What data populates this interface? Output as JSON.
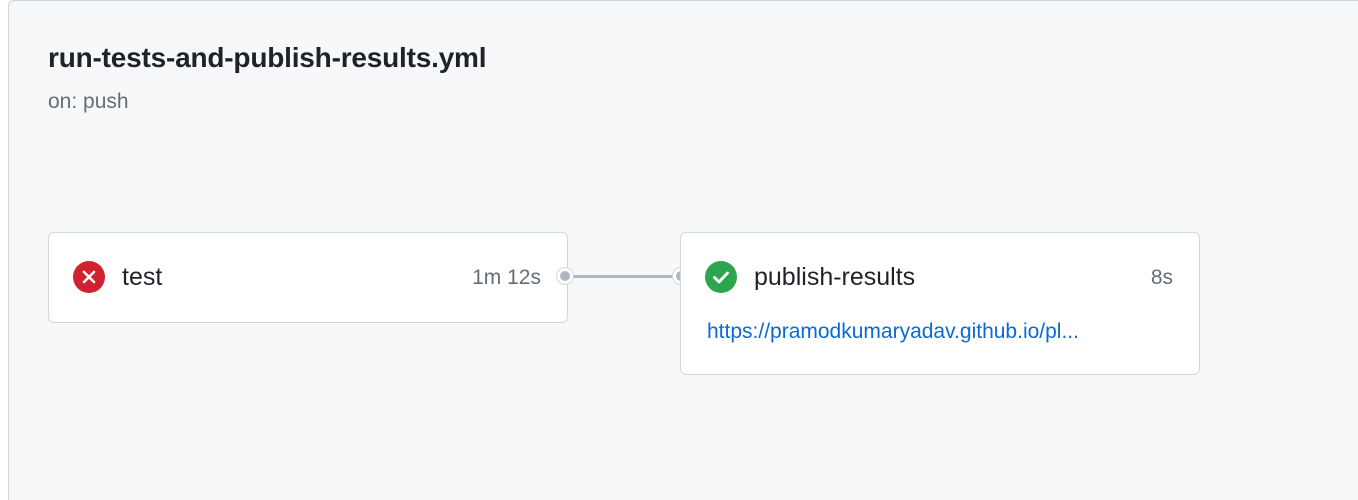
{
  "workflow": {
    "title": "run-tests-and-publish-results.yml",
    "trigger": "on: push"
  },
  "jobs": [
    {
      "name": "test",
      "status": "failure",
      "status_icon": "x-circle-icon",
      "duration": "1m 12s"
    },
    {
      "name": "publish-results",
      "status": "success",
      "status_icon": "check-circle-icon",
      "duration": "8s",
      "link": "https://pramodkumaryadav.github.io/pl..."
    }
  ],
  "colors": {
    "failure": "#cf222e",
    "success": "#2da44e",
    "link": "#0969da",
    "connector": "#afb8c1"
  }
}
